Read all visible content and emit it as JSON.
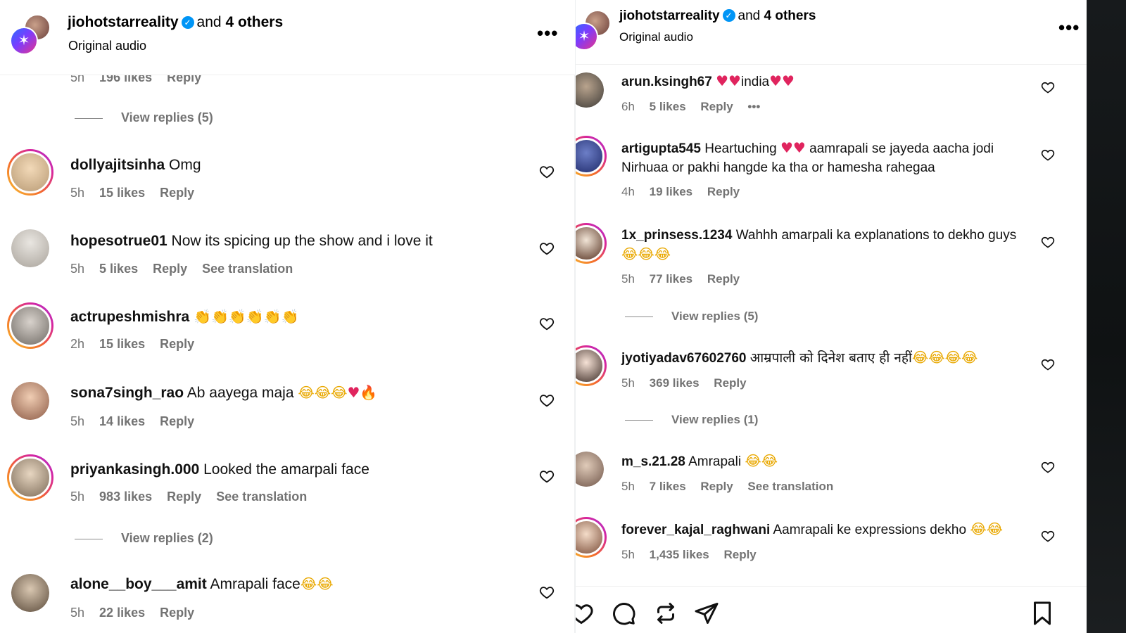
{
  "header": {
    "account": "jiohotstarreality",
    "and_text": "and",
    "others_count": "4 others",
    "subtitle": "Original audio"
  },
  "left": {
    "partial": {
      "time": "5h",
      "likes": "196 likes",
      "reply": "Reply"
    },
    "view_replies_top": "View replies (5)",
    "comments": [
      {
        "user": "dollyajitsinha",
        "text": "Omg",
        "time": "5h",
        "likes": "15 likes",
        "reply": "Reply"
      },
      {
        "user": "hopesotrue01",
        "text": "Now its spicing up the show and i love it",
        "time": "5h",
        "likes": "5 likes",
        "reply": "Reply",
        "translation": "See translation"
      },
      {
        "user": "actrupeshmishra",
        "text": "",
        "time": "2h",
        "likes": "15 likes",
        "reply": "Reply"
      },
      {
        "user": "sona7singh_rao",
        "text": "Ab aayega maja",
        "time": "5h",
        "likes": "14 likes",
        "reply": "Reply"
      },
      {
        "user": "priyankasingh.000",
        "text": "Looked the amarpali face",
        "time": "5h",
        "likes": "983 likes",
        "reply": "Reply",
        "translation": "See translation"
      },
      {
        "user": "alone__boy___amit",
        "text": "Amrapali face",
        "time": "5h",
        "likes": "22 likes",
        "reply": "Reply"
      }
    ],
    "view_replies_bottom": "View replies (2)"
  },
  "right": {
    "comments": [
      {
        "user": "arun.ksingh67",
        "text": "india",
        "time": "6h",
        "likes": "5 likes",
        "reply": "Reply"
      },
      {
        "user": "artigupta545",
        "text": "Heartuching",
        "text2": "aamrapali se jayeda aacha",
        "text3": "jodi Nirhuaa or pakhi hangde ka tha or hamesha rahegaa",
        "time": "4h",
        "likes": "19 likes",
        "reply": "Reply"
      },
      {
        "user": "1x_prinsess.1234",
        "text": "Wahhh amarpali ka explanations to dekho",
        "text2": "guys",
        "time": "5h",
        "likes": "77 likes",
        "reply": "Reply"
      },
      {
        "user": "jyotiyadav67602760",
        "text": "आम्रपाली को दिनेश बताए ही नहीं",
        "time": "5h",
        "likes": "369 likes",
        "reply": "Reply"
      },
      {
        "user": "m_s.21.28",
        "text": "Amrapali",
        "time": "5h",
        "likes": "7 likes",
        "reply": "Reply",
        "translation": "See translation"
      },
      {
        "user": "forever_kajal_raghwani",
        "text": "Aamrapali ke expressions dekho",
        "time": "5h",
        "likes": "1,435 likes",
        "reply": "Reply"
      }
    ],
    "view_replies_1": "View replies (5)",
    "view_replies_2": "View replies (1)"
  },
  "icons": {
    "like": "heart-icon",
    "comment": "comment-icon",
    "repost": "repost-icon",
    "share": "share-icon",
    "save": "bookmark-icon",
    "more": "more-icon"
  },
  "colors": {
    "verified": "#0095f6",
    "meta_text": "#737373",
    "heart_emoji": "#e0245e"
  }
}
